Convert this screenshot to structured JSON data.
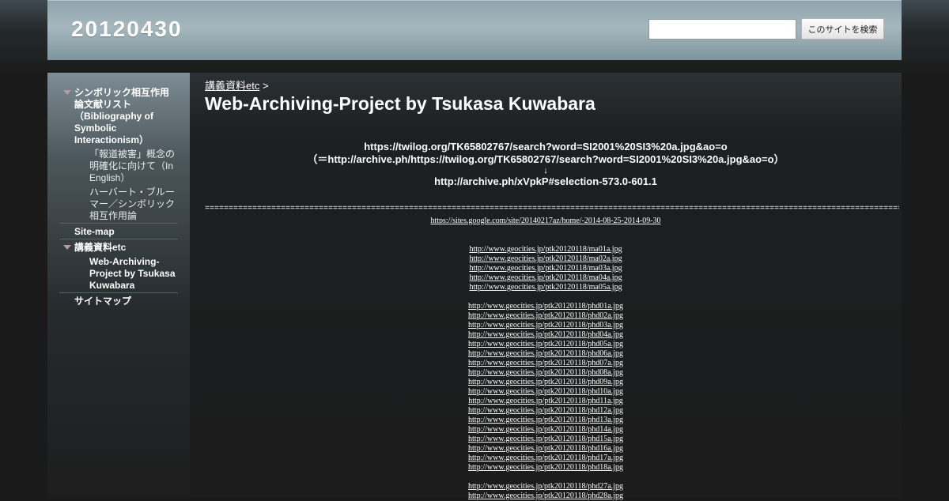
{
  "site": {
    "title": "20120430",
    "search": {
      "button_label": "このサイトを検索",
      "placeholder": "",
      "value": ""
    }
  },
  "sidebar": {
    "items": [
      {
        "label": "シンボリック相互作用論文献リスト（Bibliography of Symbolic Interactionism）"
      },
      {
        "label": "「報道被害」概念の明確化に向けて（In English）"
      },
      {
        "label": "ハーバート・ブルーマー／シンボリック相互作用論"
      },
      {
        "label": "Site-map"
      },
      {
        "label": "講義資料etc"
      },
      {
        "label": "Web-Archiving-Project by Tsukasa Kuwabara"
      },
      {
        "label": "サイトマップ"
      }
    ]
  },
  "main": {
    "breadcrumb": {
      "link": "講義資料etc",
      "separator": ">"
    },
    "title": "Web-Archiving-Project by Tsukasa Kuwabara",
    "lines": [
      "https://twilog.org/TK65802767/search?word=SI2001%20SI3%20a.jpg&ao=o",
      "（＝http://archive.ph/https://twilog.org/TK65802767/search?word=SI2001%20SI3%20a.jpg&ao=o）",
      "↓",
      "http://archive.ph/xVpkP#selection-573.0-601.1"
    ],
    "rule": "========================================================================================================================================================",
    "sites_link": "https://sites.google.com/site/20140217az/home/-2014-08-25-2014-09-30",
    "link_groups": [
      [
        "http://www.geocities.jp/ptk20120118/ma01a.jpg",
        "http://www.geocities.jp/ptk20120118/ma02a.jpg",
        "http://www.geocities.jp/ptk20120118/ma03a.jpg",
        "http://www.geocities.jp/ptk20120118/ma04a.jpg",
        "http://www.geocities.jp/ptk20120118/ma05a.jpg"
      ],
      [
        "http://www.geocities.jp/ptk20120118/phd01a.jpg",
        "http://www.geocities.jp/ptk20120118/phd02a.jpg",
        "http://www.geocities.jp/ptk20120118/phd03a.jpg",
        "http://www.geocities.jp/ptk20120118/phd04a.jpg",
        "http://www.geocities.jp/ptk20120118/phd05a.jpg",
        "http://www.geocities.jp/ptk20120118/phd06a.jpg",
        "http://www.geocities.jp/ptk20120118/phd07a.jpg",
        "http://www.geocities.jp/ptk20120118/phd08a.jpg",
        "http://www.geocities.jp/ptk20120118/phd09a.jpg",
        "http://www.geocities.jp/ptk20120118/phd10a.jpg",
        "http://www.geocities.jp/ptk20120118/phd11a.jpg",
        "http://www.geocities.jp/ptk20120118/phd12a.jpg",
        "http://www.geocities.jp/ptk20120118/phd13a.jpg",
        "http://www.geocities.jp/ptk20120118/phd14a.jpg",
        "http://www.geocities.jp/ptk20120118/phd15a.jpg",
        "http://www.geocities.jp/ptk20120118/phd16a.jpg",
        "http://www.geocities.jp/ptk20120118/phd17a.jpg",
        "http://www.geocities.jp/ptk20120118/phd18a.jpg"
      ],
      [
        "http://www.geocities.jp/ptk20120118/phd27a.jpg",
        "http://www.geocities.jp/ptk20120118/phd28a.jpg"
      ]
    ]
  }
}
